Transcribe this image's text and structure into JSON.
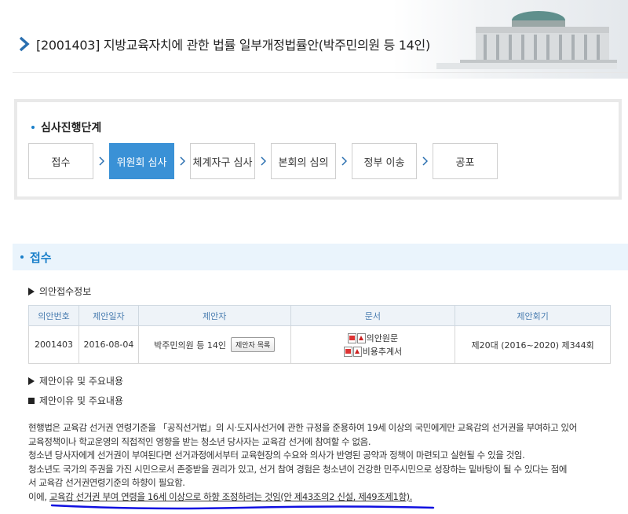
{
  "header": {
    "title": "[2001403] 지방교육자치에 관한 법률 일부개정법률안(박주민의원 등 14인)"
  },
  "stage": {
    "title": "심사진행단계",
    "steps": [
      {
        "label": "접수",
        "active": false
      },
      {
        "label": "위원회 심사",
        "active": true
      },
      {
        "label": "체계자구 심사",
        "active": false
      },
      {
        "label": "본회의 심의",
        "active": false
      },
      {
        "label": "정부 이송",
        "active": false
      },
      {
        "label": "공포",
        "active": false
      }
    ]
  },
  "section": {
    "title": "접수",
    "receipt_info_label": "의안접수정보",
    "table": {
      "headers": [
        "의안번호",
        "제안일자",
        "제안자",
        "문서",
        "제안회기"
      ],
      "row": {
        "bill_no": "2001403",
        "date": "2016-08-04",
        "proposer": "박주민의원 등 14인",
        "proposer_button": "제안자 목록",
        "doc1": "의안원문",
        "doc2": "비용추계서",
        "session": "제20대 (2016~2020) 제344회"
      }
    },
    "reason_toggle_label": "제안이유 및 주요내용",
    "reason_heading": "제안이유 및 주요내용",
    "body_lines": [
      "현행법은 교육감 선거권 연령기준을 「공직선거법」의 시·도지사선거에 관한 규정을 준용하여 19세 이상의 국민에게만 교육감의 선거권을 부여하고 있어",
      "교육정책이나 학교운영의 직접적인 영향을 받는 청소년 당사자는 교육감 선거에 참여할 수 없음.",
      "청소년 당사자에게 선거권이 부여된다면 선거과정에서부터 교육현장의 수요와 의사가 반영된 공약과 정책이 마련되고 실현될 수 있을 것임.",
      "청소년도 국가의 주권을 가진 시민으로서 존중받을 권리가 있고, 선거 참여 경험은 청소년이 건강한 민주시민으로 성장하는 밑바탕이 될 수 있다는 점에",
      "서 교육감 선거권연령기준의 하향이 필요함."
    ],
    "last_line_prefix": "이에, ",
    "last_line_underlined": "교육감 선거권 부여 연령을 16세 이상으로 하향 조정하려는 것임(안 제43조의2 신설, 제49조제1항)."
  },
  "colors": {
    "accent": "#1a7fc9",
    "active_step": "#3a91d6",
    "pen_mark": "#1010e0"
  }
}
